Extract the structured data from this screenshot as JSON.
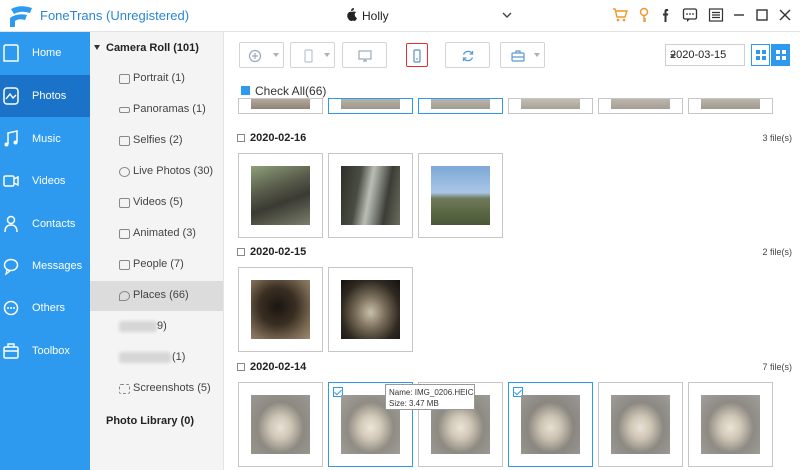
{
  "app": {
    "title": "FoneTrans (Unregistered)",
    "device": "Holly",
    "accent": "#2d9af0"
  },
  "titlebar_icons": [
    "cart-icon",
    "key-icon",
    "facebook-icon",
    "chat-icon",
    "menu-icon",
    "minimize-icon",
    "maximize-icon",
    "close-icon"
  ],
  "nav": {
    "items": [
      {
        "label": "Home",
        "icon": "home-icon"
      },
      {
        "label": "Photos",
        "icon": "photos-icon",
        "active": true
      },
      {
        "label": "Music",
        "icon": "music-icon"
      },
      {
        "label": "Videos",
        "icon": "videos-icon"
      },
      {
        "label": "Contacts",
        "icon": "contacts-icon"
      },
      {
        "label": "Messages",
        "icon": "messages-icon"
      },
      {
        "label": "Others",
        "icon": "others-icon"
      },
      {
        "label": "Toolbox",
        "icon": "toolbox-icon"
      }
    ]
  },
  "albums": {
    "camera_roll": "Camera Roll (101)",
    "items": [
      {
        "label": "Portrait (1)"
      },
      {
        "label": "Panoramas (1)"
      },
      {
        "label": "Selfies (2)"
      },
      {
        "label": "Live Photos (30)"
      },
      {
        "label": "Videos (5)"
      },
      {
        "label": "Animated (3)"
      },
      {
        "label": "People (7)"
      },
      {
        "label": "Places (66)",
        "active": true
      },
      {
        "label": "9)"
      },
      {
        "label": "(1)"
      },
      {
        "label": "Screenshots (5)"
      }
    ],
    "photo_library": "Photo Library (0)"
  },
  "toolbar": {
    "date": "2020-03-15"
  },
  "main": {
    "check_all": "Check All(66)",
    "groups": [
      {
        "date": "2020-02-16",
        "count": "3 file(s)"
      },
      {
        "date": "2020-02-15",
        "count": "2 file(s)"
      },
      {
        "date": "2020-02-14",
        "count": "7 file(s)"
      }
    ],
    "tooltip": {
      "name": "Name: IMG_0206.HEIC",
      "size": "Size: 3.47 MB"
    }
  }
}
